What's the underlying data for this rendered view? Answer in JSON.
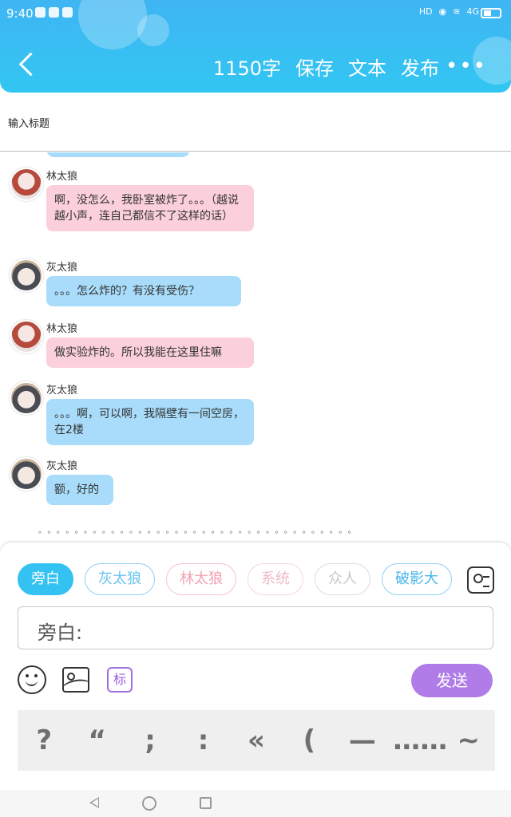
{
  "status_bar": {
    "time": "9:40",
    "network_label": "HD",
    "signal_label": "4G"
  },
  "header": {
    "word_count": "1150字",
    "save_label": "保存",
    "text_label": "文本",
    "publish_label": "发布",
    "more_label": "•••"
  },
  "title_input": {
    "placeholder": "输入标题"
  },
  "messages": [
    {
      "speaker": "林太狼",
      "text": "啊，没怎么，我卧室被炸了。。。（越说越小声，连自己都信不了这样的话）"
    },
    {
      "speaker": "灰太狼",
      "text": "。。。怎么炸的？有没有受伤？"
    },
    {
      "speaker": "林太狼",
      "text": "做实验炸的。所以我能在这里住嘛"
    },
    {
      "speaker": "灰太狼",
      "text": "。。。啊，可以啊，我隔壁有一间空房，在2楼"
    },
    {
      "speaker": "灰太狼",
      "text": "额，好的"
    }
  ],
  "divider_dots": "。。。。。。。。。。。。。。。。。。。。。。。。。。。。。。。。。。。",
  "roles": [
    {
      "label": "旁白"
    },
    {
      "label": "灰太狼"
    },
    {
      "label": "林太狼"
    },
    {
      "label": "系统"
    },
    {
      "label": "众人"
    },
    {
      "label": "破影大"
    }
  ],
  "composer": {
    "prefix": "旁白:",
    "tag_label": "标",
    "send_label": "发送"
  },
  "punctuation": [
    "?",
    "“",
    ";",
    ":",
    "«",
    "(",
    "—",
    "……",
    "~"
  ],
  "colors": {
    "header": "#3fb5f3",
    "pink_bubble": "#fbd0da",
    "blue_bubble": "#a8dcfa",
    "send": "#b07ce8"
  }
}
